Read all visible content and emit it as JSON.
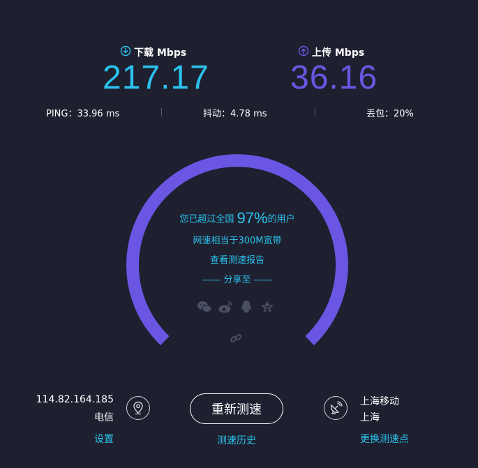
{
  "download": {
    "label": "下载 Mbps",
    "value": "217.17",
    "icon": "download-icon"
  },
  "upload": {
    "label": "上传 Mbps",
    "value": "36.16",
    "icon": "upload-icon"
  },
  "stats": {
    "ping": "PING：33.96 ms",
    "jitter": "抖动：4.78 ms",
    "loss": "丢包：20%"
  },
  "gauge": {
    "beat_prefix": "您已超过全国",
    "beat_percent": "97%",
    "beat_suffix": "的用户",
    "equivalent": "网速相当于300M宽带",
    "report_link": "查看测速报告",
    "share_label": "分享至",
    "share_icons": [
      "wechat-icon",
      "weibo-icon",
      "qq-icon",
      "qzone-icon",
      "link-icon"
    ],
    "arc_color": "#6a56e2"
  },
  "client": {
    "ip": "114.82.164.185",
    "isp": "电信",
    "settings": "设置",
    "icon": "location-pin-icon"
  },
  "retest": {
    "button": "重新测速",
    "history": "测速历史"
  },
  "server": {
    "name": "上海移动",
    "city": "上海",
    "change": "更换测速点",
    "icon": "satellite-dish-icon"
  },
  "colors": {
    "background": "#1e2030",
    "download": "#2bc3ee",
    "upload": "#6a56e2",
    "link": "#2bc3ee"
  }
}
